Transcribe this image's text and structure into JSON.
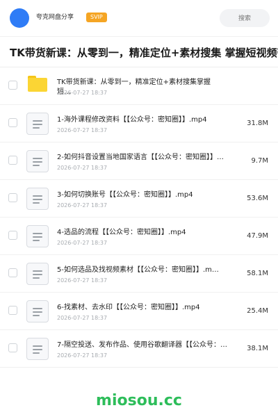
{
  "header": {
    "user_name": "夸克网盘分享",
    "badge": "SVIP",
    "search_placeholder": "搜索"
  },
  "page": {
    "title": "TK带货新课：从零到一，精准定位+素材搜集 掌握短视频带货"
  },
  "folder": {
    "name": "TK带货新课：从零到一，精准定位+素材搜集掌握短…",
    "date": "2026-07-27 18:37"
  },
  "files": [
    {
      "name": "1-海外课程修改资料【【公众号：密知圈】】.mp4",
      "date": "2026-07-27 18:37",
      "size": "31.8M"
    },
    {
      "name": "2-如何抖音设置当地国家语言【【公众号：密知圈】】…",
      "date": "2026-07-27 18:37",
      "size": "9.7M"
    },
    {
      "name": "3-如何切换账号【【公众号：密知圈】】.mp4",
      "date": "2026-07-27 18:37",
      "size": "53.6M"
    },
    {
      "name": "4-选品的流程【【公众号：密知圈】】.mp4",
      "date": "2026-07-27 18:37",
      "size": "47.9M"
    },
    {
      "name": "5-如何选品及找视频素材【【公众号：密知圈】】.m…",
      "date": "2026-07-27 18:37",
      "size": "58.1M"
    },
    {
      "name": "6-找素材、去水印【【公众号：密知圈】】.mp4",
      "date": "2026-07-27 18:37",
      "size": "25.4M"
    },
    {
      "name": "7-隔空投送、发布作品、使用谷歌翻译器【【公众号：…",
      "date": "2026-07-27 18:37",
      "size": "38.1M"
    }
  ],
  "watermark": "miosou.cc",
  "colors": {
    "accent": "#2f7cf6",
    "svip": "#f5a524",
    "folder": "#fbd534",
    "watermark": "#2dbd5a"
  }
}
